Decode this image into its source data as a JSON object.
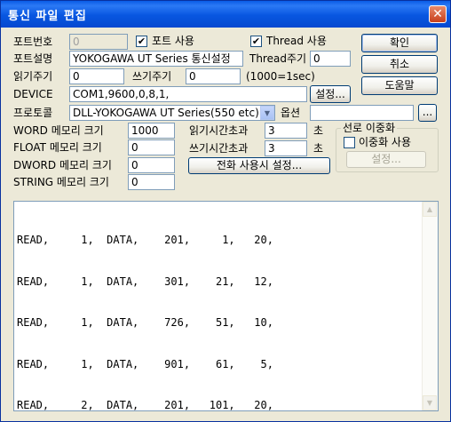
{
  "window": {
    "title": "통신 파일 편집",
    "close_glyph": "✕"
  },
  "port": {
    "number_label": "포트번호",
    "number_value": "0",
    "use_label": "포트 사용",
    "use_checked": true,
    "thread_label": "Thread 사용",
    "thread_checked": true,
    "desc_label": "포트설명",
    "desc_value": "YOKOGAWA UT Series 통신설정",
    "thread_period_label": "Thread주기",
    "thread_period_value": "0"
  },
  "timing": {
    "read_label": "읽기주기",
    "read_value": "0",
    "write_label": "쓰기주기",
    "write_value": "0",
    "unit_note": "(1000=1sec)"
  },
  "device": {
    "label": "DEVICE",
    "value": "COM1,9600,0,8,1,",
    "settings_button": "설정..."
  },
  "protocol": {
    "label": "프로토콜",
    "selected": "DLL-YOKOGAWA UT Series(550 etc)",
    "option_label": "옵션",
    "option_value": "",
    "browse_button": "..."
  },
  "memory": {
    "word_label": "WORD 메모리 크기",
    "word_value": "1000",
    "float_label": "FLOAT 메모리 크기",
    "float_value": "0",
    "dword_label": "DWORD 메모리 크기",
    "dword_value": "0",
    "string_label": "STRING 메모리 크기",
    "string_value": "0"
  },
  "timeouts": {
    "read_label": "읽기시간초과",
    "read_value": "3",
    "read_unit": "초",
    "write_label": "쓰기시간초과",
    "write_value": "3",
    "write_unit": "초",
    "phone_button": "전화 사용시 설정..."
  },
  "redundancy": {
    "group_title": "선로 이중화",
    "use_label": "이중화 사용",
    "use_checked": false,
    "settings_button": "설정..."
  },
  "buttons": {
    "ok": "확인",
    "cancel": "취소",
    "help": "도움말"
  },
  "editor": {
    "lines": [
      "READ,     1,  DATA,    201,     1,   20,",
      "READ,     1,  DATA,    301,    21,   12,",
      "READ,     1,  DATA,    726,    51,   10,",
      "READ,     1,  DATA,    901,    61,    5,",
      "READ,     2,  DATA,    201,   101,   20,"
    ]
  },
  "icons": {
    "check": "✔",
    "dropdown": "▼",
    "scroll_up": "▲",
    "scroll_down": "▼"
  }
}
